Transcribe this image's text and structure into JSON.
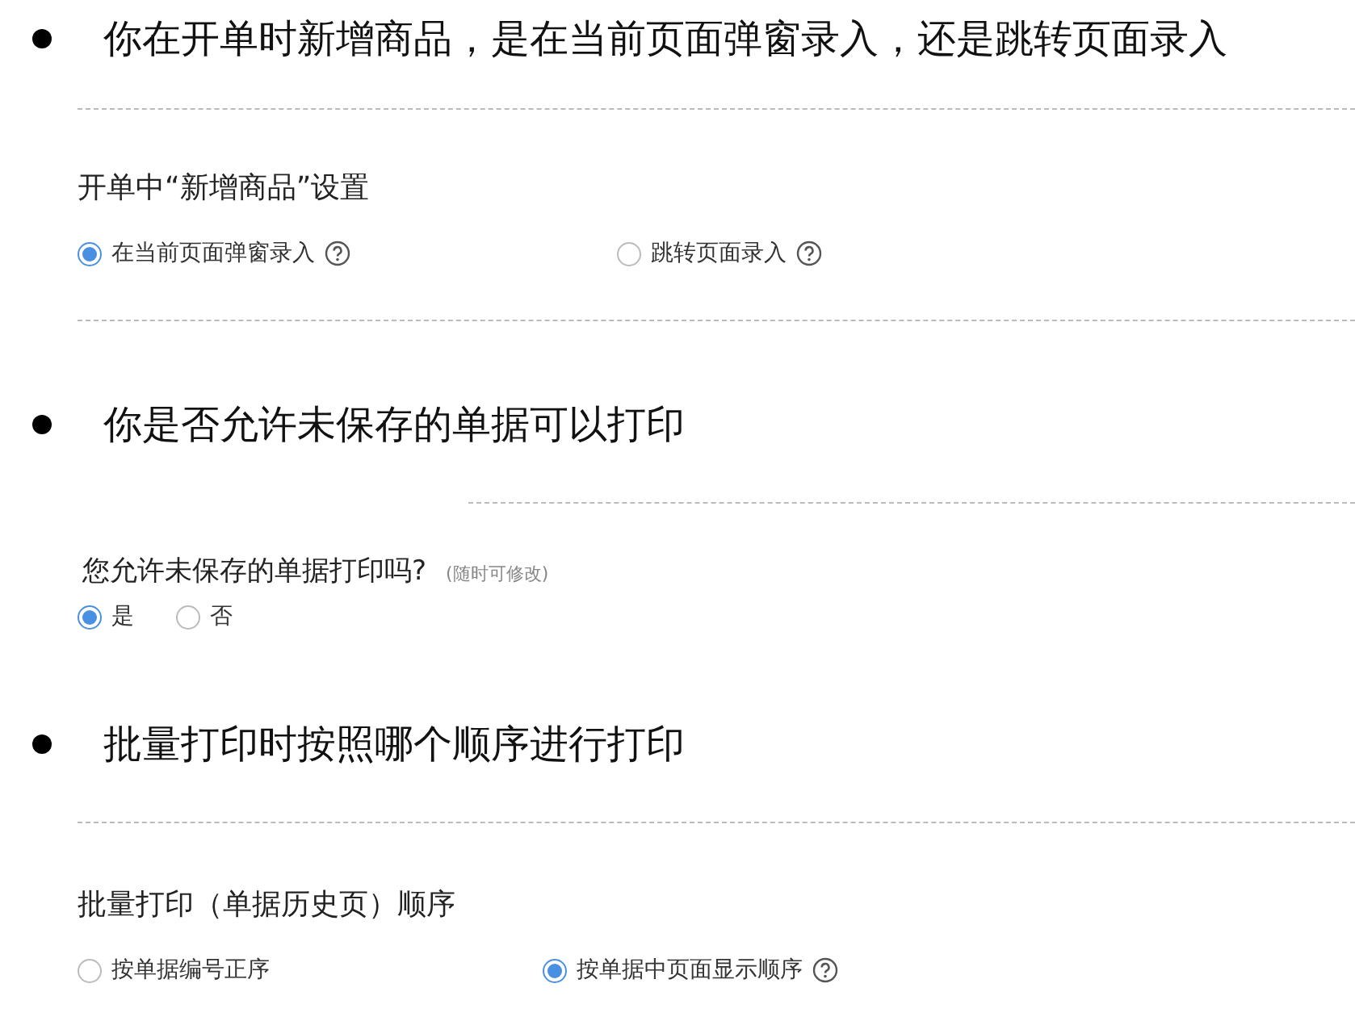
{
  "sections": [
    {
      "heading": "你在开单时新增商品，是在当前页面弹窗录入，还是跳转页面录入",
      "setting": {
        "title": "开单中“新增商品”设置",
        "closing_rule": true,
        "options": [
          {
            "label": "在当前页面弹窗录入",
            "selected": true,
            "help": true
          },
          {
            "label": "跳转页面录入",
            "selected": false,
            "help": true
          }
        ]
      }
    },
    {
      "heading": "你是否允许未保存的单据可以打印",
      "setting": {
        "title": "您允许未保存的单据打印吗?",
        "note": "(随时可修改)",
        "closing_rule": false,
        "options": [
          {
            "label": "是",
            "selected": true,
            "help": false
          },
          {
            "label": "否",
            "selected": false,
            "help": false
          }
        ]
      }
    },
    {
      "heading": "批量打印时按照哪个顺序进行打印",
      "setting": {
        "title": "批量打印（单据历史页）顺序",
        "closing_rule": false,
        "options": [
          {
            "label": "按单据编号正序",
            "selected": false,
            "help": false
          },
          {
            "label": "按单据中页面显示顺序",
            "selected": true,
            "help": true
          }
        ]
      }
    }
  ]
}
